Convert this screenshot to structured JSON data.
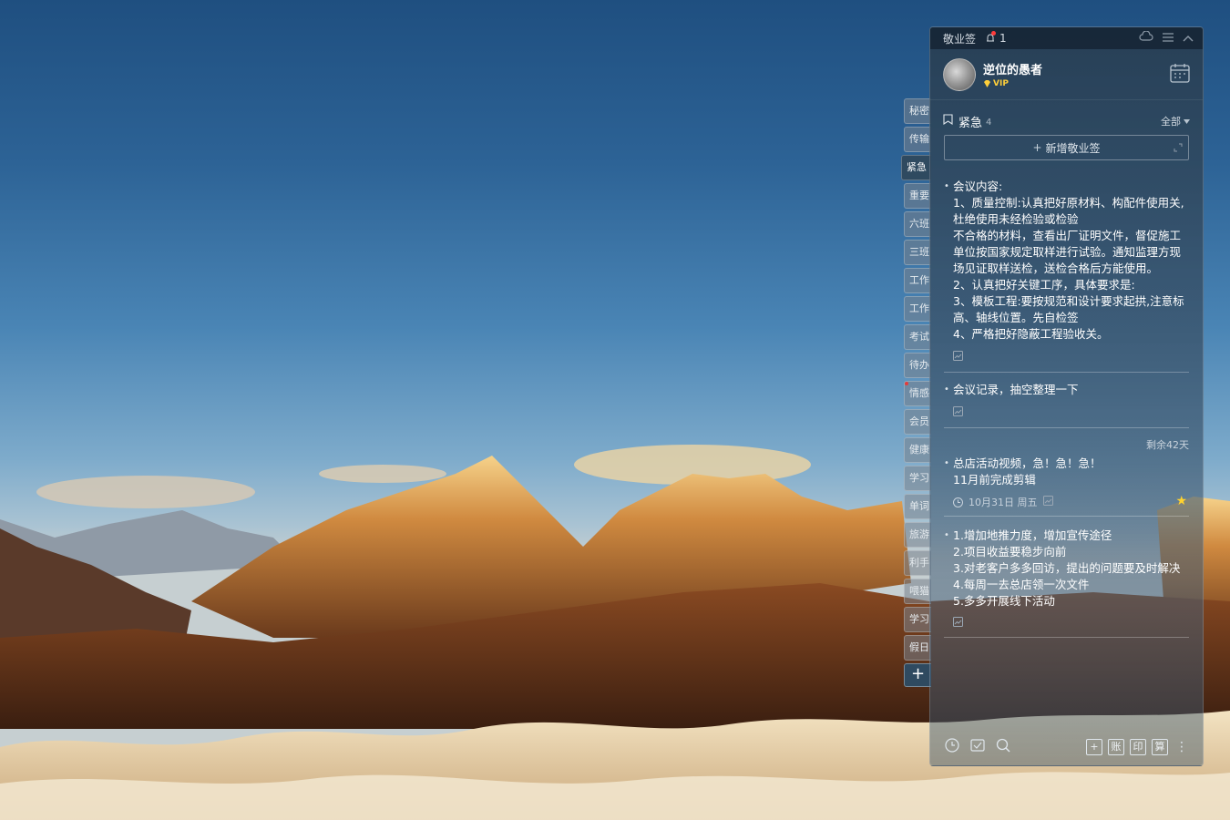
{
  "app": {
    "title": "敬业签",
    "notification_count": "1"
  },
  "user": {
    "name": "逆位的愚者",
    "badge": "VIP"
  },
  "list": {
    "name": "紧急",
    "count": "4",
    "filter": "全部",
    "new_note_label": "新增敬业签"
  },
  "side_tabs": [
    {
      "label": "秘密",
      "active": false,
      "has_dot": false
    },
    {
      "label": "传输",
      "active": false,
      "has_dot": false
    },
    {
      "label": "紧急",
      "active": true,
      "has_dot": false
    },
    {
      "label": "重要",
      "active": false,
      "has_dot": false
    },
    {
      "label": "六班",
      "active": false,
      "has_dot": false
    },
    {
      "label": "三班",
      "active": false,
      "has_dot": false
    },
    {
      "label": "工作",
      "active": false,
      "has_dot": false
    },
    {
      "label": "工作",
      "active": false,
      "has_dot": false
    },
    {
      "label": "考试",
      "active": false,
      "has_dot": false
    },
    {
      "label": "待办",
      "active": false,
      "has_dot": false
    },
    {
      "label": "情感",
      "active": false,
      "has_dot": true
    },
    {
      "label": "会员",
      "active": false,
      "has_dot": false
    },
    {
      "label": "健康",
      "active": false,
      "has_dot": false
    },
    {
      "label": "学习",
      "active": false,
      "has_dot": false
    },
    {
      "label": "单词",
      "active": false,
      "has_dot": false
    },
    {
      "label": "旅游",
      "active": false,
      "has_dot": false
    },
    {
      "label": "利手",
      "active": false,
      "has_dot": false
    },
    {
      "label": "喂猫",
      "active": false,
      "has_dot": false
    },
    {
      "label": "学习",
      "active": false,
      "has_dot": false
    },
    {
      "label": "假日",
      "active": false,
      "has_dot": false
    }
  ],
  "notes": [
    {
      "text": "会议内容:\n1、质量控制:认真把好原材料、构配件使用关,杜绝使用未经检验或检验\n不合格的材料，查看出厂证明文件，督促施工单位按国家规定取样进行试验。通知监理方现场见证取样送检，送检合格后方能使用。\n2、认真把好关键工序，具体要求是:\n3、模板工程:要按规范和设计要求起拱,注意标高、轴线位置。先自检签\n4、严格把好隐蔽工程验收关。"
    },
    {
      "text": "会议记录，抽空整理一下"
    },
    {
      "text": "总店活动视频，急！急！急！\n11月前完成剪辑",
      "remaining": "剩余42天",
      "date": "10月31日 周五"
    },
    {
      "text": "1.增加地推力度，增加宣传途径\n2.项目收益要稳步向前\n3.对老客户多多回访，提出的问题要及时解决\n4.每周一去总店领一次文件\n5.多多开展线下活动"
    }
  ],
  "bottom_toolbar": {
    "right_buttons": [
      "+",
      "账",
      "印",
      "算"
    ]
  },
  "icons": {
    "notification": "bell-icon",
    "cloud": "cloud-icon",
    "menu": "menu-icon",
    "collapse": "chevron-up-icon",
    "calendar": "calendar-icon",
    "list_flag": "bookmark-icon",
    "clock": "clock-icon",
    "check_box": "checklist-icon",
    "search": "search-icon",
    "star": "star-icon",
    "attachment": "attachment-icon"
  },
  "colors": {
    "star": "#ffd22e",
    "vip": "#ffcf3a",
    "notification_dot": "#ff3b3b"
  }
}
